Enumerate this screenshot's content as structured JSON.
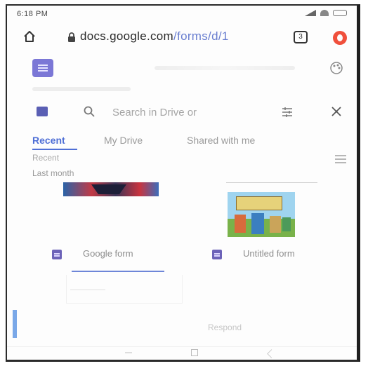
{
  "status_bar": {
    "time": "6:18 PM"
  },
  "browser": {
    "url_host": "docs.google.com",
    "url_path": "/forms/d/1",
    "tab_count": "3"
  },
  "picker": {
    "search_placeholder": "Search in Drive or",
    "tabs": [
      {
        "label": "Recent",
        "active": true
      },
      {
        "label": "My Drive",
        "active": false
      },
      {
        "label": "Shared with me",
        "active": false
      }
    ],
    "section_recent": "Recent",
    "section_last_month": "Last month",
    "files": [
      {
        "name": "Google form"
      },
      {
        "name": "Untitled form"
      }
    ],
    "footer_text": "Respond"
  },
  "colors": {
    "accent": "#4f6fd6",
    "forms_purple": "#7b77d6",
    "opera_red": "#f0503c"
  },
  "icons": {
    "home": "home-icon",
    "lock": "lock-icon",
    "tabs": "tabs-icon",
    "browser_menu": "opera-icon",
    "app": "forms-icon",
    "palette": "palette-icon",
    "folder": "folder-icon",
    "search": "search-icon",
    "filter": "filter-icon",
    "close": "close-icon",
    "list_view": "list-view-icon"
  }
}
